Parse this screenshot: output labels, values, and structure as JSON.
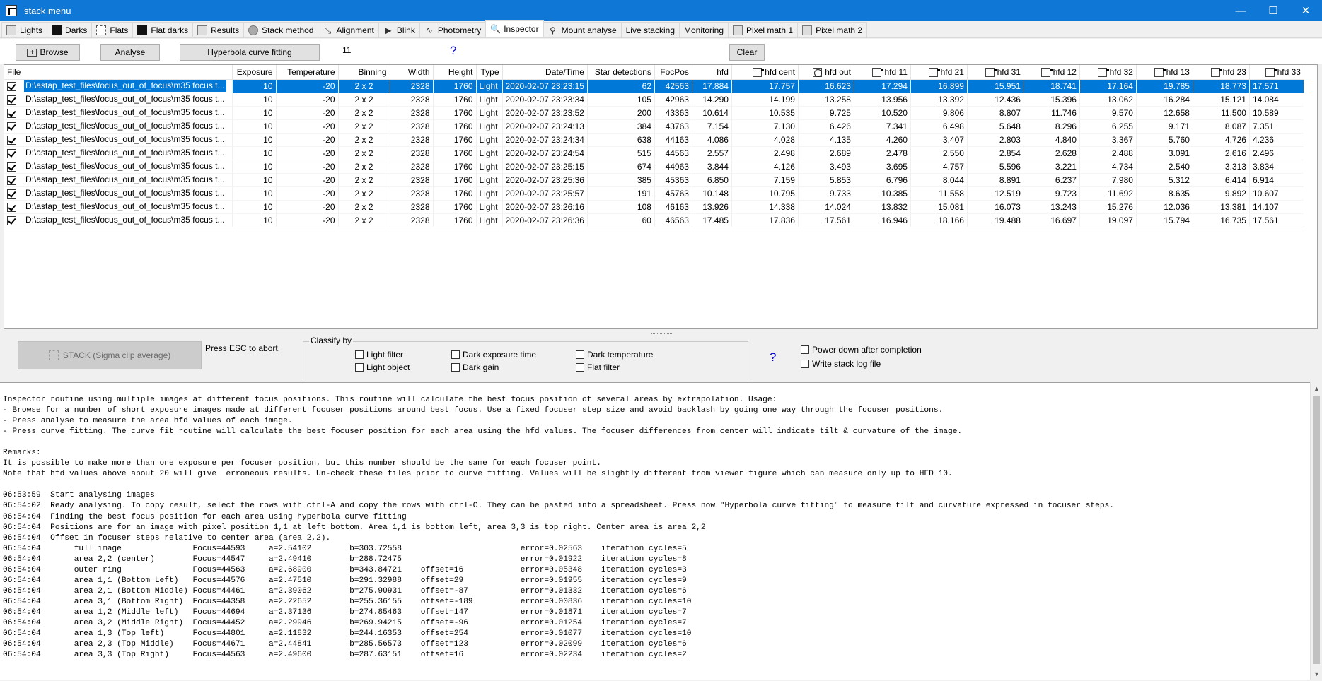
{
  "window": {
    "title": "stack menu",
    "minimize": "—",
    "maximize": "☐",
    "close": "✕"
  },
  "tabs": [
    {
      "label": "Lights",
      "icon": "lights-icon",
      "style": "plain"
    },
    {
      "label": "Darks",
      "icon": "darks-icon",
      "style": "black"
    },
    {
      "label": "Flats",
      "icon": "flats-icon",
      "style": "dash"
    },
    {
      "label": "Flat darks",
      "icon": "flat-darks-icon",
      "style": "black"
    },
    {
      "label": "Results",
      "icon": "results-icon",
      "style": "plain"
    },
    {
      "label": "Stack method",
      "icon": "stack-method-icon",
      "style": "circ"
    },
    {
      "label": "Alignment",
      "icon": "alignment-icon",
      "style": "glyph",
      "glyph": "⤡"
    },
    {
      "label": "Blink",
      "icon": "blink-icon",
      "style": "glyph",
      "glyph": "▶"
    },
    {
      "label": "Photometry",
      "icon": "photometry-icon",
      "style": "glyph",
      "glyph": "∿"
    },
    {
      "label": "Inspector",
      "icon": "magnifier-icon",
      "style": "glyph",
      "glyph": "🔍"
    },
    {
      "label": "Mount analyse",
      "icon": "telescope-icon",
      "style": "glyph",
      "glyph": "⚲"
    },
    {
      "label": "Live stacking",
      "icon": "",
      "style": "none"
    },
    {
      "label": "Monitoring",
      "icon": "",
      "style": "none"
    },
    {
      "label": "Pixel math 1",
      "icon": "pixel-math-1-icon",
      "style": "plain"
    },
    {
      "label": "Pixel math 2",
      "icon": "pixel-math-2-icon",
      "style": "plain"
    }
  ],
  "active_tab": "Inspector",
  "toolbar": {
    "browse": "Browse",
    "analyse": "Analyse",
    "hyperbola": "Hyperbola curve fitting",
    "count": "11",
    "help": "?",
    "clear": "Clear"
  },
  "table": {
    "columns": [
      "File",
      "Exposure",
      "Temperature",
      "Binning",
      "Width",
      "Height",
      "Type",
      "Date/Time",
      "Star detections",
      "FocPos",
      "hfd",
      "hfd cent",
      "hfd out",
      "hfd 11",
      "hfd 21",
      "hfd 31",
      "hfd 12",
      "hfd 32",
      "hfd 13",
      "hfd 23",
      "hfd 33"
    ],
    "rows": [
      {
        "file": "D:\\astap_test_files\\focus_out_of_focus\\m35 focus t...",
        "exposure": "10",
        "temperature": "-20",
        "binning": "2 x 2",
        "width": "2328",
        "height": "1760",
        "type": "Light",
        "datetime": "2020-02-07 23:23:15",
        "stars": "62",
        "focpos": "42563",
        "hfd": "17.884",
        "hfd_cent": "17.757",
        "hfd_out": "16.623",
        "hfd11": "17.294",
        "hfd21": "16.899",
        "hfd31": "15.951",
        "hfd12": "18.741",
        "hfd32": "17.164",
        "hfd13": "19.785",
        "hfd23": "18.773",
        "hfd33": "17.571"
      },
      {
        "file": "D:\\astap_test_files\\focus_out_of_focus\\m35 focus t...",
        "exposure": "10",
        "temperature": "-20",
        "binning": "2 x 2",
        "width": "2328",
        "height": "1760",
        "type": "Light",
        "datetime": "2020-02-07 23:23:34",
        "stars": "105",
        "focpos": "42963",
        "hfd": "14.290",
        "hfd_cent": "14.199",
        "hfd_out": "13.258",
        "hfd11": "13.956",
        "hfd21": "13.392",
        "hfd31": "12.436",
        "hfd12": "15.396",
        "hfd32": "13.062",
        "hfd13": "16.284",
        "hfd23": "15.121",
        "hfd33": "14.084"
      },
      {
        "file": "D:\\astap_test_files\\focus_out_of_focus\\m35 focus t...",
        "exposure": "10",
        "temperature": "-20",
        "binning": "2 x 2",
        "width": "2328",
        "height": "1760",
        "type": "Light",
        "datetime": "2020-02-07 23:23:52",
        "stars": "200",
        "focpos": "43363",
        "hfd": "10.614",
        "hfd_cent": "10.535",
        "hfd_out": "9.725",
        "hfd11": "10.520",
        "hfd21": "9.806",
        "hfd31": "8.807",
        "hfd12": "11.746",
        "hfd32": "9.570",
        "hfd13": "12.658",
        "hfd23": "11.500",
        "hfd33": "10.589"
      },
      {
        "file": "D:\\astap_test_files\\focus_out_of_focus\\m35 focus t...",
        "exposure": "10",
        "temperature": "-20",
        "binning": "2 x 2",
        "width": "2328",
        "height": "1760",
        "type": "Light",
        "datetime": "2020-02-07 23:24:13",
        "stars": "384",
        "focpos": "43763",
        "hfd": "7.154",
        "hfd_cent": "7.130",
        "hfd_out": "6.426",
        "hfd11": "7.341",
        "hfd21": "6.498",
        "hfd31": "5.648",
        "hfd12": "8.296",
        "hfd32": "6.255",
        "hfd13": "9.171",
        "hfd23": "8.087",
        "hfd33": "7.351"
      },
      {
        "file": "D:\\astap_test_files\\focus_out_of_focus\\m35 focus t...",
        "exposure": "10",
        "temperature": "-20",
        "binning": "2 x 2",
        "width": "2328",
        "height": "1760",
        "type": "Light",
        "datetime": "2020-02-07 23:24:34",
        "stars": "638",
        "focpos": "44163",
        "hfd": "4.086",
        "hfd_cent": "4.028",
        "hfd_out": "4.135",
        "hfd11": "4.260",
        "hfd21": "3.407",
        "hfd31": "2.803",
        "hfd12": "4.840",
        "hfd32": "3.367",
        "hfd13": "5.760",
        "hfd23": "4.726",
        "hfd33": "4.236"
      },
      {
        "file": "D:\\astap_test_files\\focus_out_of_focus\\m35 focus t...",
        "exposure": "10",
        "temperature": "-20",
        "binning": "2 x 2",
        "width": "2328",
        "height": "1760",
        "type": "Light",
        "datetime": "2020-02-07 23:24:54",
        "stars": "515",
        "focpos": "44563",
        "hfd": "2.557",
        "hfd_cent": "2.498",
        "hfd_out": "2.689",
        "hfd11": "2.478",
        "hfd21": "2.550",
        "hfd31": "2.854",
        "hfd12": "2.628",
        "hfd32": "2.488",
        "hfd13": "3.091",
        "hfd23": "2.616",
        "hfd33": "2.496"
      },
      {
        "file": "D:\\astap_test_files\\focus_out_of_focus\\m35 focus t...",
        "exposure": "10",
        "temperature": "-20",
        "binning": "2 x 2",
        "width": "2328",
        "height": "1760",
        "type": "Light",
        "datetime": "2020-02-07 23:25:15",
        "stars": "674",
        "focpos": "44963",
        "hfd": "3.844",
        "hfd_cent": "4.126",
        "hfd_out": "3.493",
        "hfd11": "3.695",
        "hfd21": "4.757",
        "hfd31": "5.596",
        "hfd12": "3.221",
        "hfd32": "4.734",
        "hfd13": "2.540",
        "hfd23": "3.313",
        "hfd33": "3.834"
      },
      {
        "file": "D:\\astap_test_files\\focus_out_of_focus\\m35 focus t...",
        "exposure": "10",
        "temperature": "-20",
        "binning": "2 x 2",
        "width": "2328",
        "height": "1760",
        "type": "Light",
        "datetime": "2020-02-07 23:25:36",
        "stars": "385",
        "focpos": "45363",
        "hfd": "6.850",
        "hfd_cent": "7.159",
        "hfd_out": "5.853",
        "hfd11": "6.796",
        "hfd21": "8.044",
        "hfd31": "8.891",
        "hfd12": "6.237",
        "hfd32": "7.980",
        "hfd13": "5.312",
        "hfd23": "6.414",
        "hfd33": "6.914"
      },
      {
        "file": "D:\\astap_test_files\\focus_out_of_focus\\m35 focus t...",
        "exposure": "10",
        "temperature": "-20",
        "binning": "2 x 2",
        "width": "2328",
        "height": "1760",
        "type": "Light",
        "datetime": "2020-02-07 23:25:57",
        "stars": "191",
        "focpos": "45763",
        "hfd": "10.148",
        "hfd_cent": "10.795",
        "hfd_out": "9.733",
        "hfd11": "10.385",
        "hfd21": "11.558",
        "hfd31": "12.519",
        "hfd12": "9.723",
        "hfd32": "11.692",
        "hfd13": "8.635",
        "hfd23": "9.892",
        "hfd33": "10.607"
      },
      {
        "file": "D:\\astap_test_files\\focus_out_of_focus\\m35 focus t...",
        "exposure": "10",
        "temperature": "-20",
        "binning": "2 x 2",
        "width": "2328",
        "height": "1760",
        "type": "Light",
        "datetime": "2020-02-07 23:26:16",
        "stars": "108",
        "focpos": "46163",
        "hfd": "13.926",
        "hfd_cent": "14.338",
        "hfd_out": "14.024",
        "hfd11": "13.832",
        "hfd21": "15.081",
        "hfd31": "16.073",
        "hfd12": "13.243",
        "hfd32": "15.276",
        "hfd13": "12.036",
        "hfd23": "13.381",
        "hfd33": "14.107"
      },
      {
        "file": "D:\\astap_test_files\\focus_out_of_focus\\m35 focus t...",
        "exposure": "10",
        "temperature": "-20",
        "binning": "2 x 2",
        "width": "2328",
        "height": "1760",
        "type": "Light",
        "datetime": "2020-02-07 23:26:36",
        "stars": "60",
        "focpos": "46563",
        "hfd": "17.485",
        "hfd_cent": "17.836",
        "hfd_out": "17.561",
        "hfd11": "16.946",
        "hfd21": "18.166",
        "hfd31": "19.488",
        "hfd12": "16.697",
        "hfd32": "19.097",
        "hfd13": "15.794",
        "hfd23": "16.735",
        "hfd33": "17.561"
      }
    ]
  },
  "stack": {
    "button": "STACK (Sigma clip average)",
    "esc": "Press ESC to abort.",
    "classify_label": "Classify by",
    "options": {
      "light_filter": "Light filter",
      "light_object": "Light object",
      "dark_exposure": "Dark exposure time",
      "dark_gain": "Dark gain",
      "dark_temperature": "Dark temperature",
      "flat_filter": "Flat filter"
    },
    "help": "?",
    "power_down": "Power down after completion",
    "write_log": "Write stack log file"
  },
  "log": {
    "lines": [
      "Inspector routine using multiple images at different focus positions. This routine will calculate the best focus position of several areas by extrapolation. Usage:",
      "- Browse for a number of short exposure images made at different focuser positions around best focus. Use a fixed focuser step size and avoid backlash by going one way through the focuser positions.",
      "- Press analyse to measure the area hfd values of each image.",
      "- Press curve fitting. The curve fit routine will calculate the best focuser position for each area using the hfd values. The focuser differences from center will indicate tilt & curvature of the image.",
      "",
      "Remarks:",
      "It is possible to make more than one exposure per focuser position, but this number should be the same for each focuser point.",
      "Note that hfd values above about 20 will give  erroneous results. Un-check these files prior to curve fitting. Values will be slightly different from viewer figure which can measure only up to HFD 10.",
      "",
      "06:53:59  Start analysing images",
      "06:54:02  Ready analysing. To copy result, select the rows with ctrl-A and copy the rows with ctrl-C. They can be pasted into a spreadsheet. Press now \"Hyperbola curve fitting\" to measure tilt and curvature expressed in focuser steps.",
      "06:54:04  Finding the best focus position for each area using hyperbola curve fitting",
      "06:54:04  Positions are for an image with pixel position 1,1 at left bottom. Area 1,1 is bottom left, area 3,3 is top right. Center area is area 2,2",
      "06:54:04  Offset in focuser steps relative to center area (area 2,2).",
      "06:54:04       full image               Focus=44593     a=2.54102        b=303.72558                         error=0.02563    iteration cycles=5",
      "06:54:04       area 2,2 (center)        Focus=44547     a=2.49410        b=288.72475                         error=0.01922    iteration cycles=8",
      "06:54:04       outer ring               Focus=44563     a=2.68900        b=343.84721    offset=16            error=0.05348    iteration cycles=3",
      "06:54:04       area 1,1 (Bottom Left)   Focus=44576     a=2.47510        b=291.32988    offset=29            error=0.01955    iteration cycles=9",
      "06:54:04       area 2,1 (Bottom Middle) Focus=44461     a=2.39062        b=275.90931    offset=-87           error=0.01332    iteration cycles=6",
      "06:54:04       area 3,1 (Bottom Right)  Focus=44358     a=2.22652        b=255.36155    offset=-189          error=0.00836    iteration cycles=10",
      "06:54:04       area 1,2 (Middle left)   Focus=44694     a=2.37136        b=274.85463    offset=147           error=0.01871    iteration cycles=7",
      "06:54:04       area 3,2 (Middle Right)  Focus=44452     a=2.29946        b=269.94215    offset=-96           error=0.01254    iteration cycles=7",
      "06:54:04       area 1,3 (Top left)      Focus=44801     a=2.11832        b=244.16353    offset=254           error=0.01077    iteration cycles=10",
      "06:54:04       area 2,3 (Top Middle)    Focus=44671     a=2.44841        b=285.56573    offset=123           error=0.02099    iteration cycles=6",
      "06:54:04       area 3,3 (Top Right)     Focus=44563     a=2.49600        b=287.63151    offset=16            error=0.02234    iteration cycles=2"
    ]
  },
  "colors": {
    "titlebar": "#0f78d7",
    "selection": "#0078d7",
    "help": "#0000cc"
  }
}
